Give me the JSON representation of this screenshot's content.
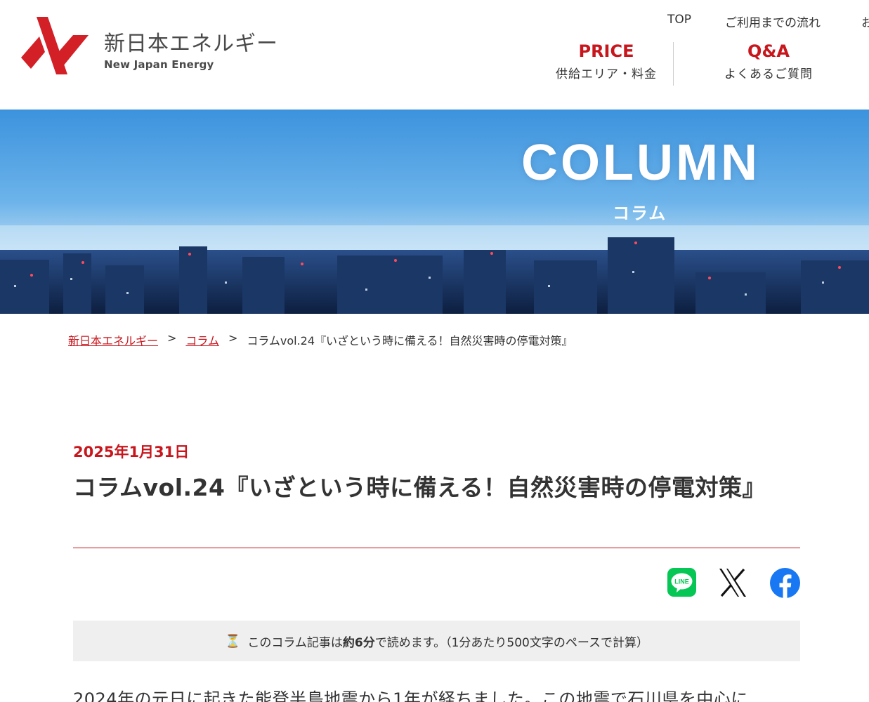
{
  "brand": {
    "name_jp": "新日本エネルギー",
    "name_en": "New Japan Energy",
    "accent_color": "#c8161d"
  },
  "top_nav": {
    "items": [
      "TOP",
      "ご利用までの流れ",
      "お"
    ]
  },
  "main_nav": {
    "price": {
      "title": "PRICE",
      "sub": "供給エリア・料金"
    },
    "qa": {
      "title": "Q&A",
      "sub": "よくあるご質問"
    }
  },
  "hero": {
    "title": "COLUMN",
    "subtitle": "コラム"
  },
  "breadcrumb": {
    "home": "新日本エネルギー",
    "separator": ">",
    "column": "コラム",
    "current": "コラムvol.24『いざという時に備える！自然災害時の停電対策』"
  },
  "article": {
    "date": "2025年1月31日",
    "title": "コラムvol.24『いざという時に備える！自然災害時の停電対策』",
    "share": [
      "line-icon",
      "x-icon",
      "facebook-icon"
    ],
    "reading_time": {
      "icon": "⏳",
      "prefix": "このコラム記事は",
      "time": "約6分",
      "suffix": "で読めます。（1分あたり500文字のペースで計算）"
    },
    "first_line": "2024年の元日に起きた能登半島地震から1年が経ちました。この地震で石川県を中心に"
  }
}
